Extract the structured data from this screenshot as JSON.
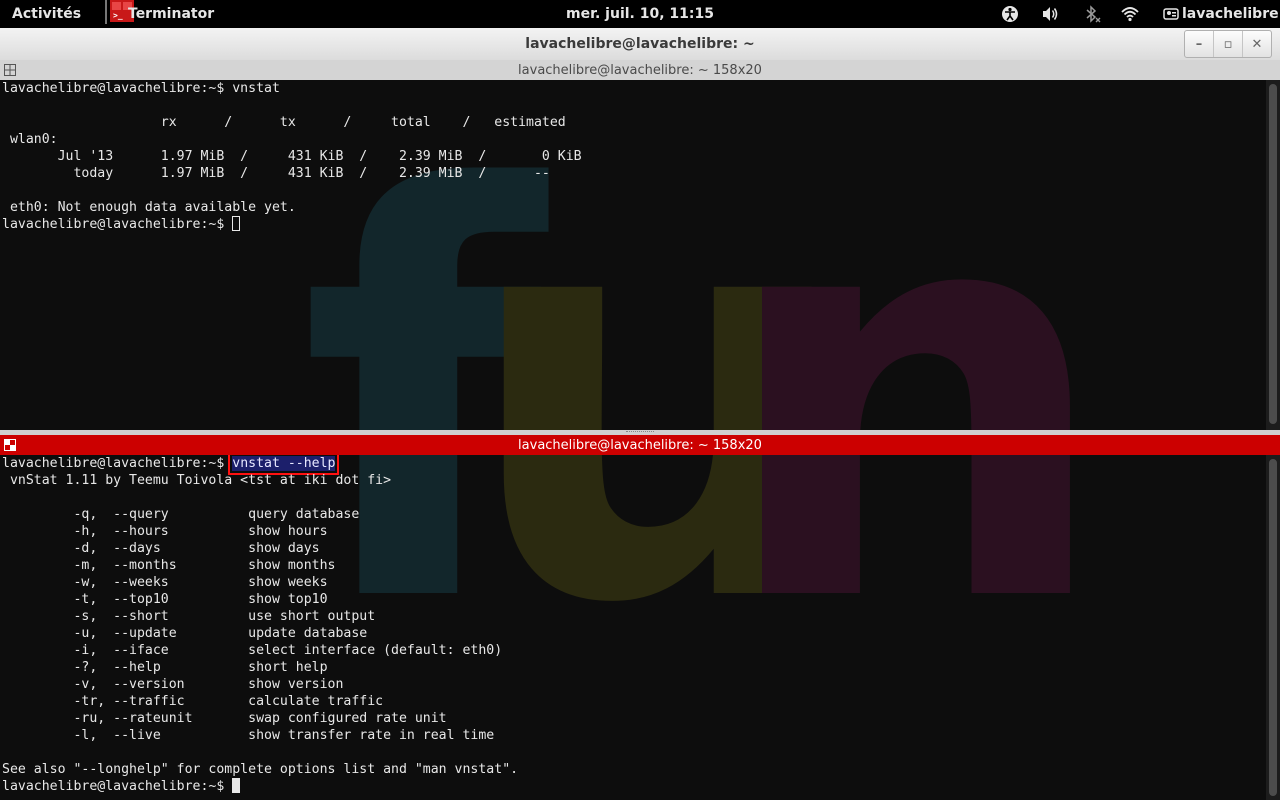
{
  "topbar": {
    "activities": "Activités",
    "app_name": "Terminator",
    "clock": "mer. juil. 10, 11:15",
    "user": "lavachelibre",
    "icons": [
      "accessibility-icon",
      "volume-icon",
      "bluetooth-icon",
      "wifi-icon",
      "user-icon"
    ]
  },
  "window": {
    "title": "lavachelibre@lavachelibre: ~",
    "buttons": [
      "minimize",
      "maximize",
      "close"
    ]
  },
  "pane1": {
    "title": "lavachelibre@lavachelibre: ~ 158x20",
    "lines": [
      "lavachelibre@lavachelibre:~$ vnstat",
      "",
      "                    rx      /      tx      /     total    /   estimated",
      " wlan0:",
      "       Jul '13      1.97 MiB  /     431 KiB  /    2.39 MiB  /       0 KiB",
      "         today      1.97 MiB  /     431 KiB  /    2.39 MiB  /      --",
      "",
      " eth0: Not enough data available yet.",
      "lavachelibre@lavachelibre:~$ "
    ]
  },
  "pane2": {
    "title": "lavachelibre@lavachelibre: ~ 158x20",
    "prompt": "lavachelibre@lavachelibre:~$ ",
    "command": "vnstat --help",
    "lines": [
      " vnStat 1.11 by Teemu Toivola <tst at iki dot fi>",
      "",
      "         -q,  --query          query database",
      "         -h,  --hours          show hours",
      "         -d,  --days           show days",
      "         -m,  --months         show months",
      "         -w,  --weeks          show weeks",
      "         -t,  --top10          show top10",
      "         -s,  --short          use short output",
      "         -u,  --update         update database",
      "         -i,  --iface          select interface (default: eth0)",
      "         -?,  --help           short help",
      "         -v,  --version        show version",
      "         -tr, --traffic        calculate traffic",
      "         -ru, --rateunit       swap configured rate unit",
      "         -l,  --live           show transfer rate in real time",
      "",
      "See also \"--longhelp\" for complete options list and \"man vnstat\".",
      "lavachelibre@lavachelibre:~$ "
    ]
  },
  "wallpaper": {
    "letters": [
      "f",
      "u",
      "n"
    ],
    "colors": [
      "#12262b",
      "#2b2a10",
      "#2b1020"
    ]
  }
}
